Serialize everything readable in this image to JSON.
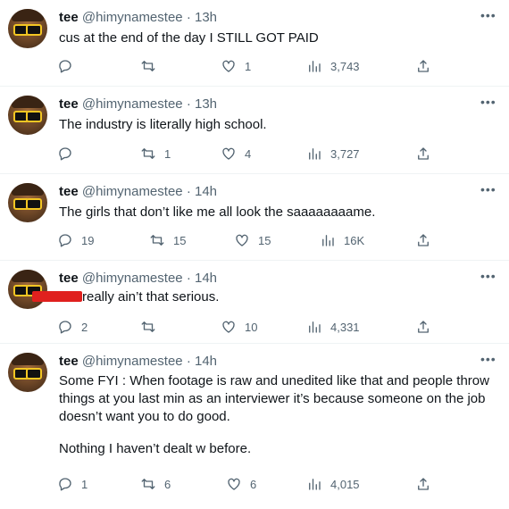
{
  "author": {
    "name": "tee",
    "handle": "@himynamestee"
  },
  "tweets": [
    {
      "time": "13h",
      "text": "cus at the end of the day I STILL GOT PAID",
      "replies": "",
      "retweets": "",
      "likes": "1",
      "views": "3,743"
    },
    {
      "time": "13h",
      "text": "The industry is literally high school.",
      "replies": "",
      "retweets": "1",
      "likes": "4",
      "views": "3,727"
    },
    {
      "time": "14h",
      "text": "The girls that don’t like me all look the saaaaaaaame.",
      "replies": "19",
      "retweets": "15",
      "likes": "15",
      "views": "16K"
    },
    {
      "time": "14h",
      "text": "really ain’t that serious.",
      "replies": "2",
      "retweets": "",
      "likes": "10",
      "views": "4,331"
    },
    {
      "time": "14h",
      "text_lines": [
        "Some FYI : When footage is raw and unedited like that and people throw",
        "things at you last min as an interviewer it’s because someone on the job",
        "doesn’t want you to do good.",
        "Nothing I haven’t dealt w before."
      ],
      "replies": "1",
      "retweets": "6",
      "likes": "6",
      "views": "4,015"
    }
  ],
  "icons": [
    "reply-icon",
    "retweet-icon",
    "like-icon",
    "views-icon",
    "share-icon",
    "more-icon"
  ],
  "colors": {
    "text": "#0f1419",
    "secondary": "#536471",
    "divider": "#eff3f4",
    "redaction": "#e0201e"
  }
}
